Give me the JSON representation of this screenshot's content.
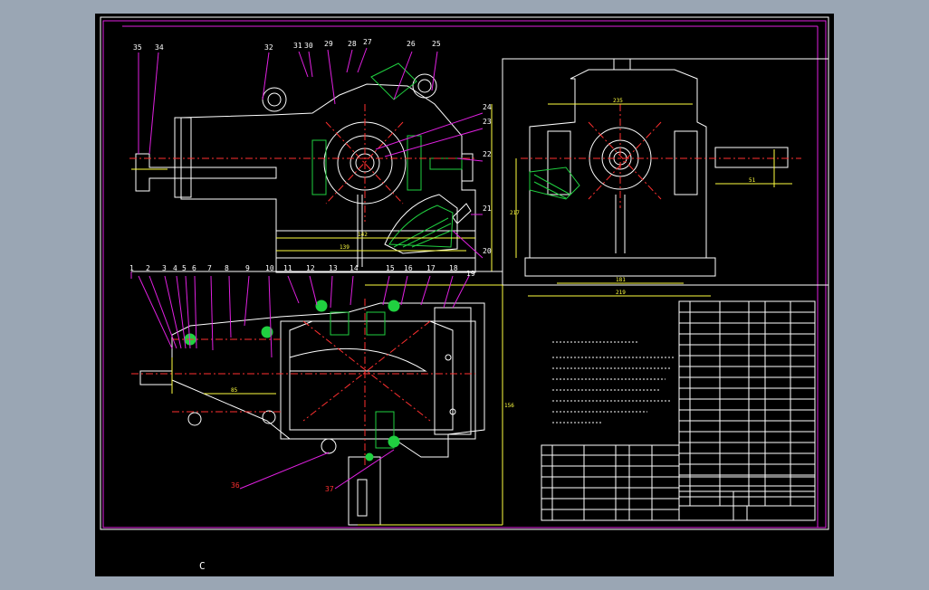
{
  "drawing": {
    "part_numbers_top": [
      "35",
      "34",
      "32",
      "31",
      "30",
      "29",
      "28",
      "27",
      "26",
      "25",
      "24",
      "23",
      "22",
      "21",
      "20"
    ],
    "part_numbers_mid": [
      "1",
      "2",
      "3",
      "4",
      "5",
      "6",
      "7",
      "8",
      "9",
      "10",
      "11",
      "12",
      "13",
      "14",
      "15",
      "16",
      "17",
      "18",
      "19"
    ],
    "part_numbers_bottom": [
      "36",
      "37"
    ],
    "dimensions": {
      "side_width": "235",
      "side_base_inner": "181",
      "side_base_outer": "219",
      "side_height": "217",
      "shaft_len": "51",
      "front_len_a": "142",
      "front_len_b": "139",
      "plan_dim": "85",
      "plan_height": "156"
    },
    "cursor_label": "C"
  },
  "colors": {
    "frame": "#e020e0",
    "outline": "#ffffff",
    "hatch": "#20d040",
    "center": "#ff3030",
    "dim": "#ffff40",
    "text": "#ffffff"
  }
}
